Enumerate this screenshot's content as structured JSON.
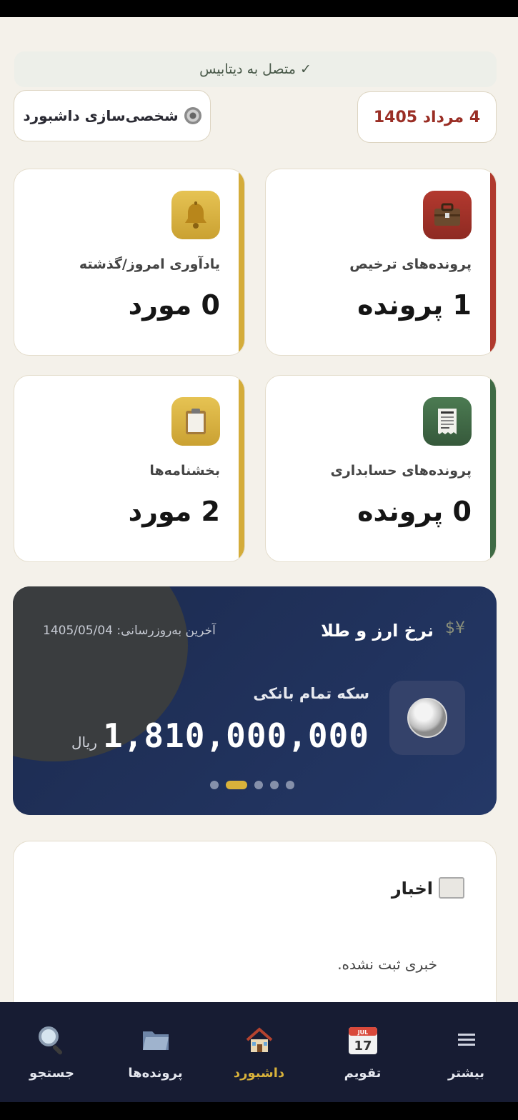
{
  "status": {
    "text": "✓ متصل به دیتابیس"
  },
  "header": {
    "date": "4 مرداد 1405",
    "customize_label": "شخصی‌سازی داشبورد"
  },
  "cards": [
    {
      "label": "پرونده‌های ترخیص",
      "value": "1 پرونده",
      "icon": "briefcase-icon",
      "color": "#b03a2e"
    },
    {
      "label": "یادآوری امروز/گذشته",
      "value": "0 مورد",
      "icon": "bell-icon",
      "color": "#d4ac3a"
    },
    {
      "label": "پرونده‌های حسابداری",
      "value": "0 پرونده",
      "icon": "receipt-icon",
      "color": "#3f6b45"
    },
    {
      "label": "بخشنامه‌ها",
      "value": "2 مورد",
      "icon": "clipboard-icon",
      "color": "#d4ac3a"
    }
  ],
  "rates": {
    "title": "نرخ ارز و طلا",
    "last_update": "آخرین به‌روزرسانی: 1405/05/04",
    "item_name": "سکه تمام بانکی",
    "amount": "1,810,000,000",
    "unit": "ریال",
    "pages": 5,
    "active_page": 2
  },
  "news": {
    "title": "اخبار",
    "empty": "خبری ثبت نشده."
  },
  "nav": [
    {
      "label": "بیشتر",
      "icon": "menu-icon"
    },
    {
      "label": "تقویم",
      "icon": "calendar-icon",
      "day": "17",
      "month": "JUL"
    },
    {
      "label": "داشبورد",
      "icon": "home-icon",
      "active": true
    },
    {
      "label": "پرونده‌ها",
      "icon": "folder-icon"
    },
    {
      "label": "جستجو",
      "icon": "search-icon"
    }
  ],
  "colors": {
    "accent": "#d9b23b",
    "navy": "#1c2a4e",
    "danger": "#9a2e25"
  }
}
